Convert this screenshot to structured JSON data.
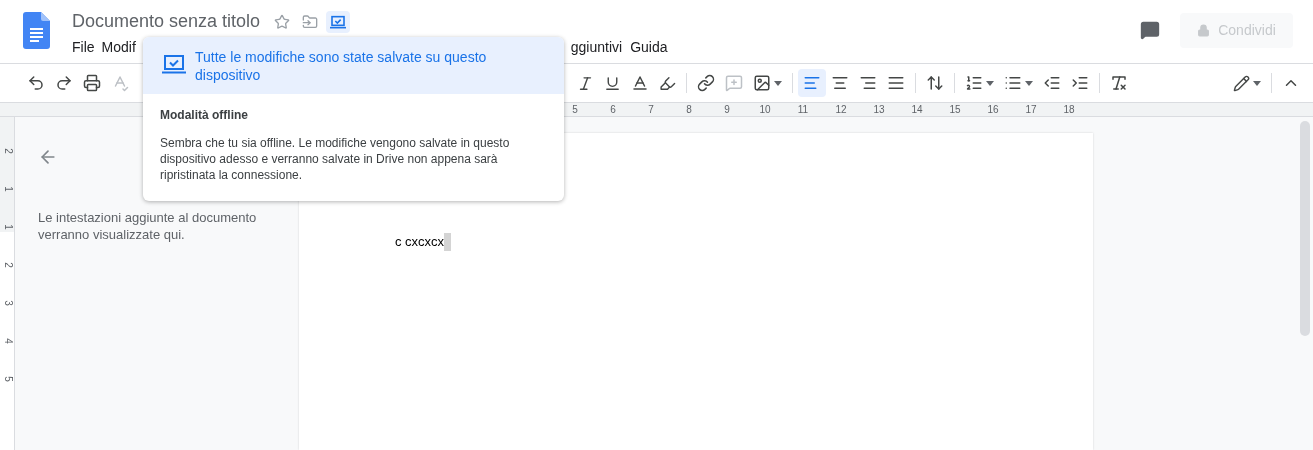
{
  "document": {
    "title": "Documento senza titolo",
    "text": "c cxcxcx"
  },
  "menu_left": [
    {
      "label": "File"
    },
    {
      "label": "Modif"
    }
  ],
  "menu_right": [
    {
      "label": "ggiuntivi"
    },
    {
      "label": "Guida"
    }
  ],
  "share_button": {
    "label": "Condividi",
    "disabled": true
  },
  "alignment_buttons": [
    {
      "kind": "left",
      "selected": true
    },
    {
      "kind": "center",
      "selected": false
    },
    {
      "kind": "right",
      "selected": false
    },
    {
      "kind": "justify",
      "selected": false
    }
  ],
  "ruler": {
    "numbers": [
      "5",
      "6",
      "7",
      "8",
      "9",
      "10",
      "11",
      "12",
      "13",
      "14",
      "15",
      "16",
      "17",
      "18"
    ]
  },
  "vertical_ruler": {
    "numbers": [
      "2",
      "1",
      "1",
      "2",
      "3",
      "4",
      "5"
    ]
  },
  "outline": {
    "text": "Le intestazioni aggiunte al documento verranno visualizzate qui."
  },
  "save_popup": {
    "status": "Tutte le modifiche sono state salvate su questo dispositivo",
    "heading": "Modalità offline",
    "body": "Sembra che tu sia offline. Le modifiche vengono salvate in questo dispositivo adesso e verranno salvate in Drive non appena sarà ripristinata la connessione."
  }
}
